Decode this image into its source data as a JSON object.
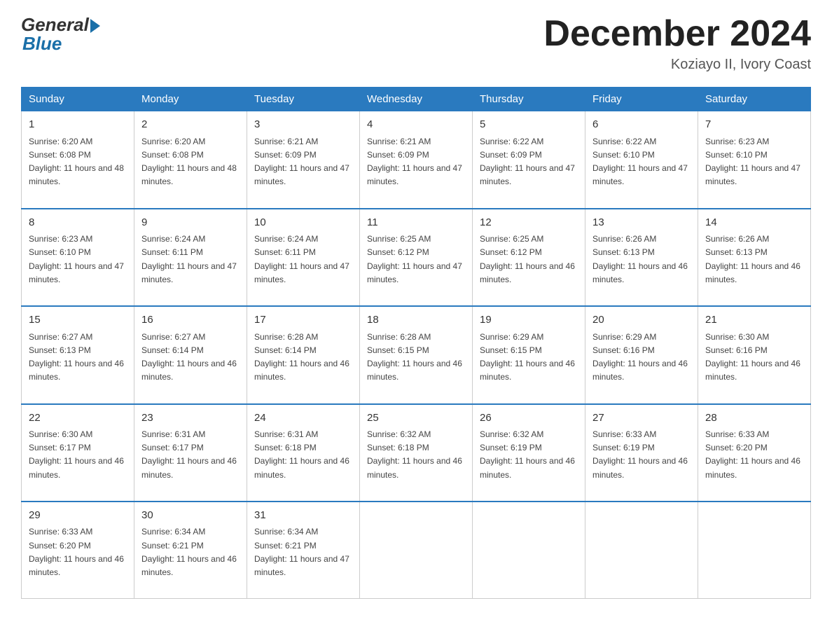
{
  "logo": {
    "general": "General",
    "blue": "Blue"
  },
  "title": "December 2024",
  "subtitle": "Koziayo II, Ivory Coast",
  "days_of_week": [
    "Sunday",
    "Monday",
    "Tuesday",
    "Wednesday",
    "Thursday",
    "Friday",
    "Saturday"
  ],
  "weeks": [
    [
      {
        "day": "1",
        "sunrise": "6:20 AM",
        "sunset": "6:08 PM",
        "daylight": "11 hours and 48 minutes."
      },
      {
        "day": "2",
        "sunrise": "6:20 AM",
        "sunset": "6:08 PM",
        "daylight": "11 hours and 48 minutes."
      },
      {
        "day": "3",
        "sunrise": "6:21 AM",
        "sunset": "6:09 PM",
        "daylight": "11 hours and 47 minutes."
      },
      {
        "day": "4",
        "sunrise": "6:21 AM",
        "sunset": "6:09 PM",
        "daylight": "11 hours and 47 minutes."
      },
      {
        "day": "5",
        "sunrise": "6:22 AM",
        "sunset": "6:09 PM",
        "daylight": "11 hours and 47 minutes."
      },
      {
        "day": "6",
        "sunrise": "6:22 AM",
        "sunset": "6:10 PM",
        "daylight": "11 hours and 47 minutes."
      },
      {
        "day": "7",
        "sunrise": "6:23 AM",
        "sunset": "6:10 PM",
        "daylight": "11 hours and 47 minutes."
      }
    ],
    [
      {
        "day": "8",
        "sunrise": "6:23 AM",
        "sunset": "6:10 PM",
        "daylight": "11 hours and 47 minutes."
      },
      {
        "day": "9",
        "sunrise": "6:24 AM",
        "sunset": "6:11 PM",
        "daylight": "11 hours and 47 minutes."
      },
      {
        "day": "10",
        "sunrise": "6:24 AM",
        "sunset": "6:11 PM",
        "daylight": "11 hours and 47 minutes."
      },
      {
        "day": "11",
        "sunrise": "6:25 AM",
        "sunset": "6:12 PM",
        "daylight": "11 hours and 47 minutes."
      },
      {
        "day": "12",
        "sunrise": "6:25 AM",
        "sunset": "6:12 PM",
        "daylight": "11 hours and 46 minutes."
      },
      {
        "day": "13",
        "sunrise": "6:26 AM",
        "sunset": "6:13 PM",
        "daylight": "11 hours and 46 minutes."
      },
      {
        "day": "14",
        "sunrise": "6:26 AM",
        "sunset": "6:13 PM",
        "daylight": "11 hours and 46 minutes."
      }
    ],
    [
      {
        "day": "15",
        "sunrise": "6:27 AM",
        "sunset": "6:13 PM",
        "daylight": "11 hours and 46 minutes."
      },
      {
        "day": "16",
        "sunrise": "6:27 AM",
        "sunset": "6:14 PM",
        "daylight": "11 hours and 46 minutes."
      },
      {
        "day": "17",
        "sunrise": "6:28 AM",
        "sunset": "6:14 PM",
        "daylight": "11 hours and 46 minutes."
      },
      {
        "day": "18",
        "sunrise": "6:28 AM",
        "sunset": "6:15 PM",
        "daylight": "11 hours and 46 minutes."
      },
      {
        "day": "19",
        "sunrise": "6:29 AM",
        "sunset": "6:15 PM",
        "daylight": "11 hours and 46 minutes."
      },
      {
        "day": "20",
        "sunrise": "6:29 AM",
        "sunset": "6:16 PM",
        "daylight": "11 hours and 46 minutes."
      },
      {
        "day": "21",
        "sunrise": "6:30 AM",
        "sunset": "6:16 PM",
        "daylight": "11 hours and 46 minutes."
      }
    ],
    [
      {
        "day": "22",
        "sunrise": "6:30 AM",
        "sunset": "6:17 PM",
        "daylight": "11 hours and 46 minutes."
      },
      {
        "day": "23",
        "sunrise": "6:31 AM",
        "sunset": "6:17 PM",
        "daylight": "11 hours and 46 minutes."
      },
      {
        "day": "24",
        "sunrise": "6:31 AM",
        "sunset": "6:18 PM",
        "daylight": "11 hours and 46 minutes."
      },
      {
        "day": "25",
        "sunrise": "6:32 AM",
        "sunset": "6:18 PM",
        "daylight": "11 hours and 46 minutes."
      },
      {
        "day": "26",
        "sunrise": "6:32 AM",
        "sunset": "6:19 PM",
        "daylight": "11 hours and 46 minutes."
      },
      {
        "day": "27",
        "sunrise": "6:33 AM",
        "sunset": "6:19 PM",
        "daylight": "11 hours and 46 minutes."
      },
      {
        "day": "28",
        "sunrise": "6:33 AM",
        "sunset": "6:20 PM",
        "daylight": "11 hours and 46 minutes."
      }
    ],
    [
      {
        "day": "29",
        "sunrise": "6:33 AM",
        "sunset": "6:20 PM",
        "daylight": "11 hours and 46 minutes."
      },
      {
        "day": "30",
        "sunrise": "6:34 AM",
        "sunset": "6:21 PM",
        "daylight": "11 hours and 46 minutes."
      },
      {
        "day": "31",
        "sunrise": "6:34 AM",
        "sunset": "6:21 PM",
        "daylight": "11 hours and 47 minutes."
      },
      null,
      null,
      null,
      null
    ]
  ]
}
